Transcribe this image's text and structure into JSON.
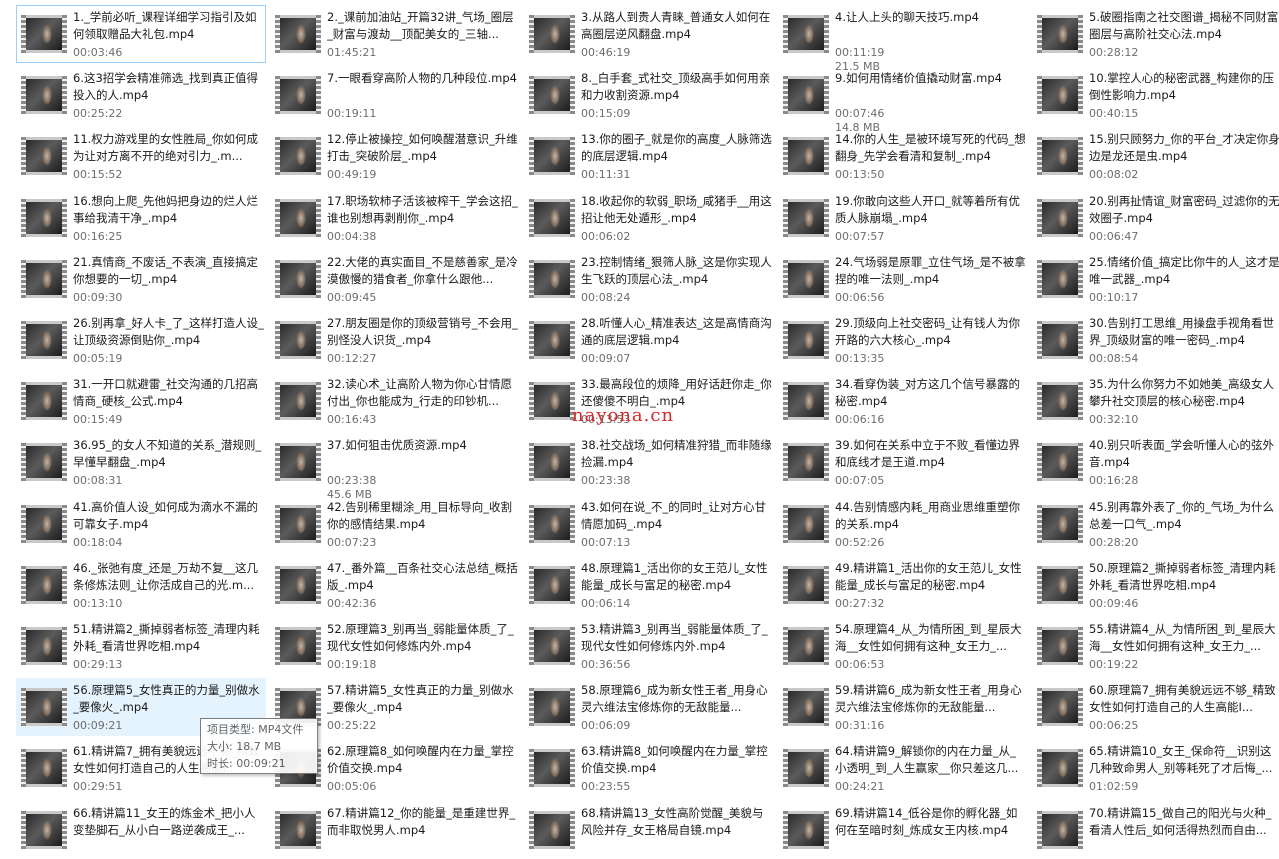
{
  "watermark": "nayona.cn",
  "tooltip": {
    "type_line": "项目类型: MP4文件",
    "size_line": "大小: 18.7 MB",
    "length_line": "时长: 00:09:21"
  },
  "files": [
    {
      "name": "1._学前必听_课程详细学习指引及如何领取赠品大礼包.mp4",
      "duration": "00:03:46",
      "size": ""
    },
    {
      "name": "2._课前加油站_开篇32讲_气场_圈层_财富与渡劫__顶配美女的_三轴...",
      "duration": "01:45:21",
      "size": ""
    },
    {
      "name": "3.从路人到贵人青睐_普通女人如何在高圈层逆风翻盘.mp4",
      "duration": "00:46:19",
      "size": ""
    },
    {
      "name": "4.让人上头的聊天技巧.mp4",
      "duration": "00:11:19",
      "size": "21.5 MB"
    },
    {
      "name": "5.破圈指南之社交图谱_揭秘不同财富圈层与高阶社交心法.mp4",
      "duration": "00:28:12",
      "size": ""
    },
    {
      "name": "6.这3招学会精准筛选_找到真正值得投入的人.mp4",
      "duration": "00:25:22",
      "size": ""
    },
    {
      "name": "7.一眼看穿高阶人物的几种段位.mp4",
      "duration": "00:19:11",
      "size": ""
    },
    {
      "name": "8._白手套_式社交_顶级高手如何用亲和力收割资源.mp4",
      "duration": "00:15:09",
      "size": ""
    },
    {
      "name": "9.如何用情绪价值撬动财富.mp4",
      "duration": "00:07:46",
      "size": "14.8 MB"
    },
    {
      "name": "10.掌控人心的秘密武器_构建你的压倒性影响力.mp4",
      "duration": "00:40:15",
      "size": ""
    },
    {
      "name": "11.权力游戏里的女性胜局_你如何成为让对方离不开的绝对引力_.m...",
      "duration": "00:15:52",
      "size": ""
    },
    {
      "name": "12.停止被操控_如何唤醒潜意识_升维打击_突破阶层_.mp4",
      "duration": "00:49:19",
      "size": ""
    },
    {
      "name": "13.你的圈子_就是你的高度_人脉筛选的底层逻辑.mp4",
      "duration": "00:11:31",
      "size": ""
    },
    {
      "name": "14.你的人生_是被环境写死的代码_想翻身_先学会看清和复制_.mp4",
      "duration": "00:13:50",
      "size": ""
    },
    {
      "name": "15.别只顾努力_你的平台_才决定你身边是龙还是虫.mp4",
      "duration": "00:08:02",
      "size": ""
    },
    {
      "name": "16.想向上爬_先他妈把身边的烂人烂事给我清干净_.mp4",
      "duration": "00:16:25",
      "size": ""
    },
    {
      "name": "17.职场软柿子活该被榨干_学会这招_谁也别想再剥削你_.mp4",
      "duration": "00:04:38",
      "size": ""
    },
    {
      "name": "18.收起你的软弱_职场_咸猪手__用这招让他无处遁形_.mp4",
      "duration": "00:06:02",
      "size": ""
    },
    {
      "name": "19.你敢向这些人开口_就等着所有优质人脉崩塌_.mp4",
      "duration": "00:07:57",
      "size": ""
    },
    {
      "name": "20.别再扯情谊_财富密码_过滤你的无效圈子.mp4",
      "duration": "00:06:47",
      "size": ""
    },
    {
      "name": "21.真情商_不废话_不表演_直接搞定你想要的一切_.mp4",
      "duration": "00:09:30",
      "size": ""
    },
    {
      "name": "22.大佬的真实面目_不是慈善家_是冷漠傲慢的猎食者_你拿什么跟他...",
      "duration": "00:09:45",
      "size": ""
    },
    {
      "name": "23.控制情绪_狠筛人脉_这是你实现人生飞跃的顶层心法_.mp4",
      "duration": "00:08:24",
      "size": ""
    },
    {
      "name": "24.气场弱是原罪_立住气场_是不被拿捏的唯一法则_.mp4",
      "duration": "00:06:56",
      "size": ""
    },
    {
      "name": "25.情绪价值_搞定比你牛的人_这才是唯一武器_.mp4",
      "duration": "00:10:17",
      "size": ""
    },
    {
      "name": "26.别再拿_好人卡_了_这样打造人设_让顶级资源倒贴你_.mp4",
      "duration": "00:05:19",
      "size": ""
    },
    {
      "name": "27.朋友圈是你的顶级营销号_不会用_别怪没人识货_.mp4",
      "duration": "00:12:27",
      "size": ""
    },
    {
      "name": "28.听懂人心_精准表达_这是高情商沟通的底层逻辑.mp4",
      "duration": "00:09:07",
      "size": ""
    },
    {
      "name": "29.顶级向上社交密码_让有钱人为你开路的六大核心_.mp4",
      "duration": "00:13:35",
      "size": ""
    },
    {
      "name": "30.告别打工思维_用操盘手视角看世界_顶级财富的唯一密码_.mp4",
      "duration": "00:08:54",
      "size": ""
    },
    {
      "name": "31.一开口就避雷_社交沟通的几招高情商_硬核_公式.mp4",
      "duration": "00:15:49",
      "size": ""
    },
    {
      "name": "32.读心术_让高阶人物为你心甘情愿付出_你也能成为_行走的印钞机...",
      "duration": "00:16:43",
      "size": ""
    },
    {
      "name": "33.最高段位的烦降_用好话赶你走_你还傻傻不明白_.mp4",
      "duration": "00:13:53",
      "size": ""
    },
    {
      "name": "34.看穿伪装_对方这几个信号暴露的秘密.mp4",
      "duration": "00:06:16",
      "size": ""
    },
    {
      "name": "35.为什么你努力不如她美_高级女人攀升社交顶层的核心秘密.mp4",
      "duration": "00:32:10",
      "size": ""
    },
    {
      "name": "36.95_的女人不知道的关系_潜规则_早懂早翻盘_.mp4",
      "duration": "00:08:31",
      "size": ""
    },
    {
      "name": "37.如何狙击优质资源.mp4",
      "duration": "00:23:38",
      "size": "45.6 MB"
    },
    {
      "name": "38.社交战场_如何精准狩猎_而非随缘捡漏.mp4",
      "duration": "00:23:38",
      "size": ""
    },
    {
      "name": "39.如何在关系中立于不败_看懂边界和底线才是王道.mp4",
      "duration": "00:07:05",
      "size": ""
    },
    {
      "name": "40.别只听表面_学会听懂人心的弦外音.mp4",
      "duration": "00:16:28",
      "size": ""
    },
    {
      "name": "41.高价值人设_如何成为滴水不漏的可靠女子.mp4",
      "duration": "00:18:04",
      "size": ""
    },
    {
      "name": "42.告别稀里糊涂_用_目标导向_收割你的感情结果.mp4",
      "duration": "00:07:23",
      "size": ""
    },
    {
      "name": "43.如何在说_不_的同时_让对方心甘情愿加码_.mp4",
      "duration": "00:07:13",
      "size": ""
    },
    {
      "name": "44.告别情感内耗_用商业思维重塑你的关系.mp4",
      "duration": "00:52:26",
      "size": ""
    },
    {
      "name": "45.别再靠外表了_你的_气场_为什么总差一口气_.mp4",
      "duration": "00:28:20",
      "size": ""
    },
    {
      "name": "46._张弛有度_还是_万劫不复__这几条修炼法则_让你活成自己的光.m...",
      "duration": "00:13:10",
      "size": ""
    },
    {
      "name": "47._番外篇__百条社交心法总结_概括版_.mp4",
      "duration": "00:42:36",
      "size": ""
    },
    {
      "name": "48.原理篇1_活出你的女王范儿_女性能量_成长与富足的秘密.mp4",
      "duration": "00:06:14",
      "size": ""
    },
    {
      "name": "49.精讲篇1_活出你的女王范儿_女性能量_成长与富足的秘密.mp4",
      "duration": "00:27:32",
      "size": ""
    },
    {
      "name": "50.原理篇2_撕掉弱者标签_清理内耗外耗_看清世界吃相.mp4",
      "duration": "00:09:46",
      "size": ""
    },
    {
      "name": "51.精讲篇2_撕掉弱者标签_清理内耗外耗_看清世界吃相.mp4",
      "duration": "00:29:13",
      "size": ""
    },
    {
      "name": "52.原理篇3_别再当_弱能量体质_了_现代女性如何修炼内外.mp4",
      "duration": "00:19:18",
      "size": ""
    },
    {
      "name": "53.精讲篇3_别再当_弱能量体质_了_现代女性如何修炼内外.mp4",
      "duration": "00:36:56",
      "size": ""
    },
    {
      "name": "54.原理篇4_从_为情所困_到_星辰大海__女性如何拥有这种_女王力_...",
      "duration": "00:06:53",
      "size": ""
    },
    {
      "name": "55.精讲篇4_从_为情所困_到_星辰大海__女性如何拥有这种_女王力_...",
      "duration": "00:19:22",
      "size": ""
    },
    {
      "name": "56.原理篇5_女性真正的力量_别做水_要像火_.mp4",
      "duration": "00:09:21",
      "size": ""
    },
    {
      "name": "57.精讲篇5_女性真正的力量_别做水_要像火_.mp4",
      "duration": "00:25:22",
      "size": ""
    },
    {
      "name": "58.原理篇6_成为新女性王者_用身心灵六维法宝修炼你的无敌能量...",
      "duration": "00:06:09",
      "size": ""
    },
    {
      "name": "59.精讲篇6_成为新女性王者_用身心灵六维法宝修炼你的无敌能量...",
      "duration": "00:31:16",
      "size": ""
    },
    {
      "name": "60.原理篇7_拥有美貌远远不够_精致女性如何打造自己的人生高能I...",
      "duration": "00:06:25",
      "size": ""
    },
    {
      "name": "61.精讲篇7_拥有美貌远远不够_精致女性如何打造自己的人生高能I...",
      "duration": "00:29:51",
      "size": ""
    },
    {
      "name": "62.原理篇8_如何唤醒内在力量_掌控价值交换.mp4",
      "duration": "00:05:06",
      "size": ""
    },
    {
      "name": "63.精讲篇8_如何唤醒内在力量_掌控价值交换.mp4",
      "duration": "00:23:55",
      "size": ""
    },
    {
      "name": "64.精讲篇9_解锁你的内在力量_从_小透明_到_人生赢家__你只差这几...",
      "duration": "00:24:21",
      "size": ""
    },
    {
      "name": "65.精讲篇10_女王_保命符__识别这几种致命男人_别等耗死了才后悔_...",
      "duration": "01:02:59",
      "size": ""
    },
    {
      "name": "66.精讲篇11_女王的炼金术_把小人变垫脚石_从小白一路逆袭成王_...",
      "duration": "",
      "size": ""
    },
    {
      "name": "67.精讲篇12_你的能量_是重建世界_而非取悦男人.mp4",
      "duration": "",
      "size": ""
    },
    {
      "name": "68.精讲篇13_女性高阶觉醒_美貌与风险并存_女王格局自镜.mp4",
      "duration": "",
      "size": ""
    },
    {
      "name": "69.精讲篇14_低谷是你的孵化器_如何在至暗时刻_炼成女王内核.mp4",
      "duration": "",
      "size": ""
    },
    {
      "name": "70.精讲篇15_做自己的阳光与火种_看清人性后_如何活得热烈而自由...",
      "duration": "",
      "size": ""
    }
  ]
}
